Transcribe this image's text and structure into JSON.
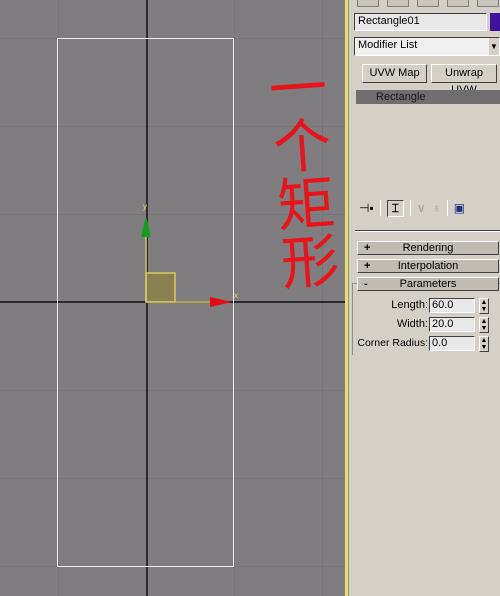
{
  "viewport": {
    "gizmo_axes": {
      "x_label": "x",
      "y_label": "y"
    },
    "annotation": "一个矩形",
    "colors": {
      "background": "#7f7d80",
      "shape": "#f0f0f0",
      "x_axis": "#e01010",
      "y_axis": "#10a020",
      "gizmo": "#d8c860"
    }
  },
  "command_panel": {
    "object_name": "Rectangle01",
    "object_color": "#4010a0",
    "modifier_list": "Modifier List",
    "buttons": [
      "UVW Map",
      "Unwrap UVW"
    ],
    "stack_item": "Rectangle",
    "rollouts": [
      {
        "sign": "+",
        "label": "Rendering"
      },
      {
        "sign": "+",
        "label": "Interpolation"
      },
      {
        "sign": "-",
        "label": "Parameters"
      }
    ],
    "parameters": [
      {
        "label": "Length:",
        "value": "60.0"
      },
      {
        "label": "Width:",
        "value": "20.0"
      },
      {
        "label": "Corner Radius:",
        "value": "0.0"
      }
    ]
  }
}
